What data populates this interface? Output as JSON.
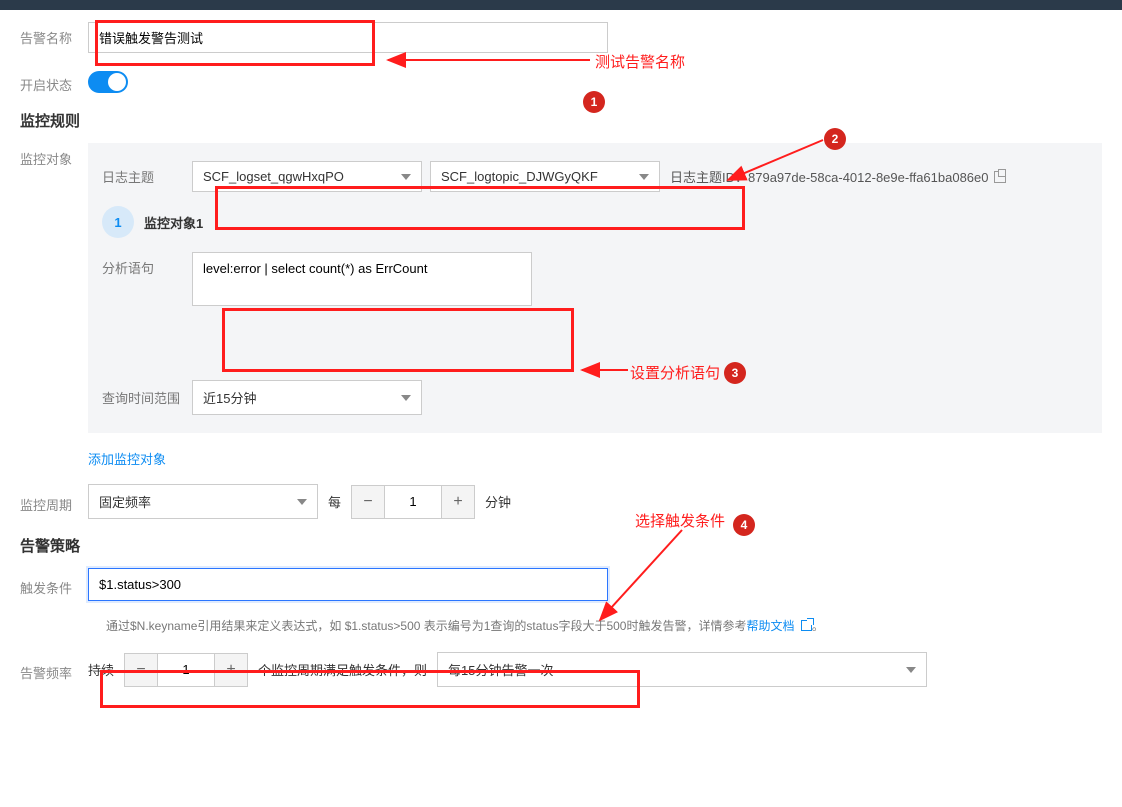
{
  "labels": {
    "alarm_name": "告警名称",
    "enable_status": "开启状态",
    "monitor_rule": "监控规则",
    "monitor_target": "监控对象",
    "log_topic": "日志主题",
    "monitor_target_1": "监控对象1",
    "analysis_stmt": "分析语句",
    "query_range": "查询时间范围",
    "add_target": "添加监控对象",
    "monitor_cycle": "监控周期",
    "every": "每",
    "minute": "分钟",
    "alarm_policy": "告警策略",
    "trigger_cond": "触发条件",
    "alarm_freq": "告警频率",
    "sustain": "持续",
    "cycles_then": "个监控周期满足触发条件，则",
    "help_doc": "帮助文档"
  },
  "values": {
    "alarm_name": "错误触发警告测试",
    "logset_select": "SCF_logset_qgwHxqPO",
    "logtopic_select": "SCF_logtopic_DJWGyQKF",
    "log_topic_id_label": "日志主题ID：",
    "log_topic_id": "879a97de-58ca-4012-8e9e-ffa61ba086e0",
    "analysis_stmt": "level:error | select count(*) as ErrCount",
    "query_range": "近15分钟",
    "cycle_type": "固定频率",
    "cycle_value": "1",
    "trigger_cond": "$1.status>300",
    "sustain_value": "1",
    "freq_select": "每15分钟告警一次",
    "helper_text": "通过$N.keyname引用结果来定义表达式，如 $1.status>500 表示编号为1查询的status字段大于500时触发告警，详情参考"
  },
  "annotations": {
    "t1": "测试告警名称",
    "t3": "设置分析语句",
    "t4": "选择触发条件",
    "b1": "1",
    "b2": "2",
    "b3": "3",
    "b4": "4"
  }
}
